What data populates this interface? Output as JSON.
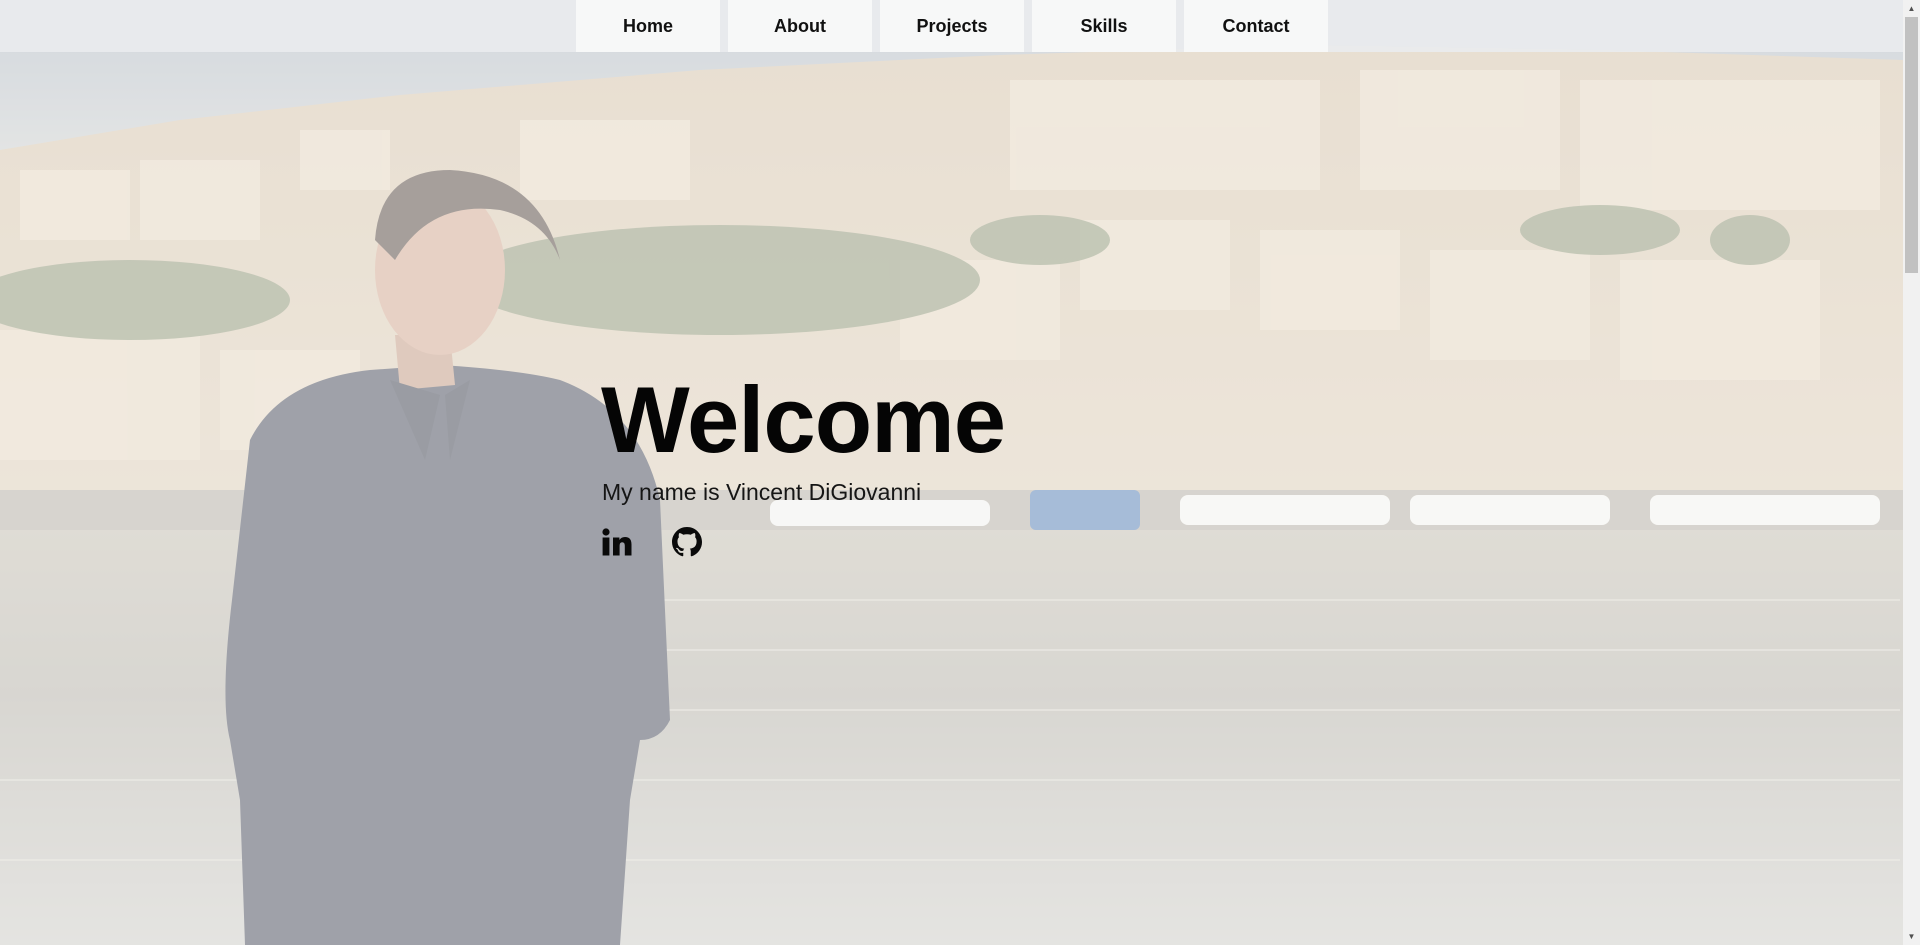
{
  "nav": {
    "items": [
      {
        "label": "Home"
      },
      {
        "label": "About"
      },
      {
        "label": "Projects"
      },
      {
        "label": "Skills"
      },
      {
        "label": "Contact"
      }
    ]
  },
  "hero": {
    "title": "Welcome",
    "subtitle": "My name is Vincent DiGiovanni",
    "social": [
      {
        "icon": "linkedin-icon"
      },
      {
        "icon": "github-icon"
      }
    ]
  },
  "colors": {
    "text": "#050505",
    "nav_bg": "#e9ecee",
    "nav_item_bg": "#f7f8f8"
  }
}
